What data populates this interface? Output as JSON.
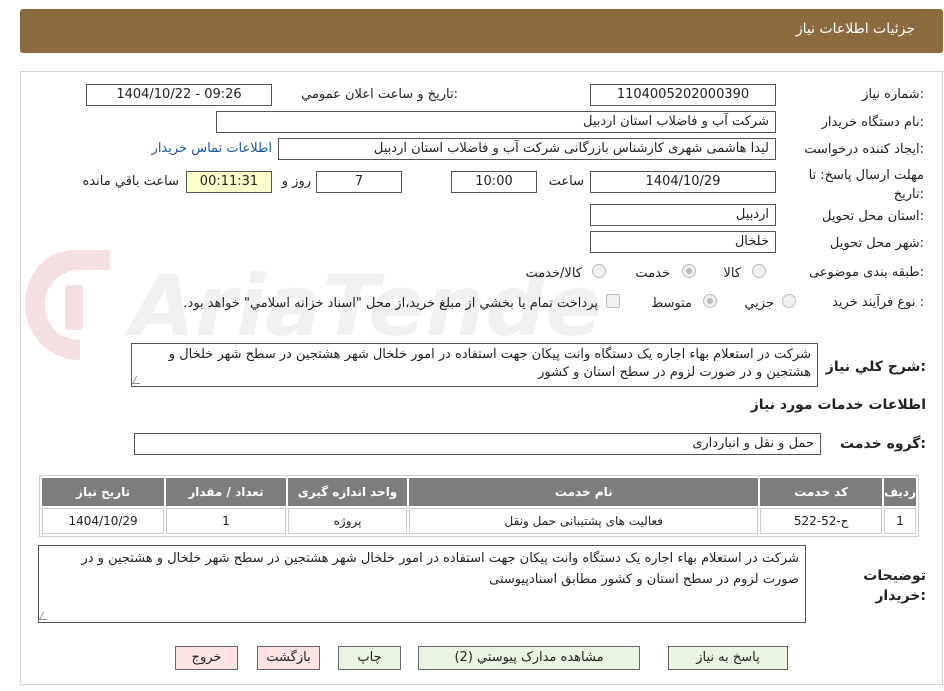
{
  "header": {
    "title": "جزئیات اطلاعات نیاز"
  },
  "labels": {
    "need_number": "شماره نیاز:",
    "announce_datetime": "تاریخ و ساعت اعلان عمومي:",
    "buyer_org": "نام دستگاه خريدار:",
    "requester": "ايجاد کننده درخواست:",
    "deadline": "مهلت ارسال پاسخ: تا تاریخ:",
    "time_word": "ساعت",
    "day_and": "روز و",
    "remaining": "ساعت باقي مانده",
    "province": "استان محل تحويل:",
    "city": "شهر محل تحويل:",
    "category": "طبقه بندی موضوعی:",
    "process_type": "نوع فرآیند خرید :",
    "general_desc": "شرح کلي نياز:",
    "services_info": "اطلاعات خدمات مورد نياز",
    "service_group": "گروه خدمت:",
    "buyer_notes": "توضيحات خريدار:"
  },
  "fields": {
    "need_number": "1104005202000390",
    "announce_datetime": "1404/10/22 - 09:26",
    "buyer_org": "شرکت آب و فاضلاب استان اردبیل",
    "requester": "لیدا  هاشمی شهری کارشناس بازرگانی شرکت آب و فاضلاب استان اردبیل",
    "contact_link": "اطلاعات تماس خريدار",
    "deadline_date": "1404/10/29",
    "deadline_time": "10:00",
    "days": "7",
    "remaining_time": "00:11:31",
    "province": "اردبیل",
    "city": "خلخال",
    "service_group": "حمل و نقل و انبارداری"
  },
  "category": {
    "options": [
      "کالا",
      "خدمت",
      "کالا/خدمت"
    ],
    "selected": "خدمت"
  },
  "process": {
    "options": [
      "جزيي",
      "متوسط"
    ],
    "selected": "متوسط",
    "treasury_note": "پرداخت تمام يا بخشي از مبلغ خريد،از محل \"اسناد خزانه اسلامي\" خواهد بود."
  },
  "general_desc": "شرکت در استعلام بهاء اجاره یک دستگاه وانت پیکان جهت استفاده در امور خلخال شهر هشتجین در سطح شهر خلخال و هشتجین و در صورت لزوم در سطح استان و کشور",
  "table": {
    "headers": [
      "رديف",
      "کد خدمت",
      "نام خدمت",
      "واحد اندازه گيری",
      "تعداد / مقدار",
      "تاریخ نیاز"
    ],
    "rows": [
      [
        "1",
        "ح-52-522",
        "فعالیت های پشتیبانی حمل ونقل",
        "پروژه",
        "1",
        "1404/10/29"
      ]
    ]
  },
  "buyer_notes": "شرکت در استعلام بهاء اجاره یک دستگاه وانت پیکان جهت استفاده در امور خلخال شهر هشتجین در سطح شهر خلخال و هشتجین و در صورت لزوم در سطح استان و کشور مطابق اسنادپیوستی",
  "buttons": {
    "reply": "پاسخ به نياز",
    "attachments": "مشاهده مدارک پيوستي (2)",
    "print": "چاپ",
    "back": "بازگشت",
    "exit": "خروج"
  },
  "watermark": "AriaTender.neT"
}
